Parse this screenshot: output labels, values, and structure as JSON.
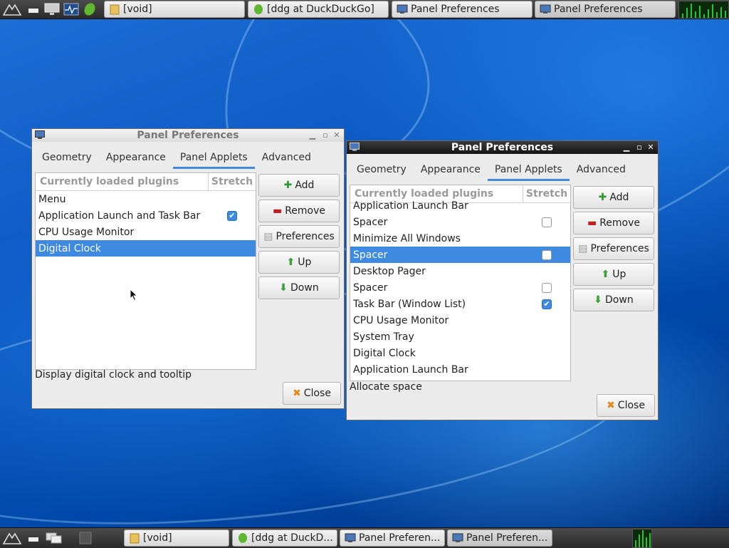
{
  "top_panel": {
    "tasks": [
      {
        "label": "[void]"
      },
      {
        "label": "[ddg at DuckDuckGo]"
      },
      {
        "label": "Panel Preferences"
      },
      {
        "label": "Panel Preferences"
      }
    ]
  },
  "bottom_panel": {
    "tasks": [
      {
        "label": "[void]"
      },
      {
        "label": "[ddg at DuckD..."
      },
      {
        "label": "Panel Preferen..."
      },
      {
        "label": "Panel Preferen..."
      }
    ]
  },
  "window1": {
    "title": "Panel Preferences",
    "tabs": [
      "Geometry",
      "Appearance",
      "Panel Applets",
      "Advanced"
    ],
    "selected_tab": "Panel Applets",
    "col_plugins": "Currently loaded plugins",
    "col_stretch": "Stretch",
    "rows": [
      {
        "name": "Menu",
        "stretch": null
      },
      {
        "name": "Application Launch and Task Bar",
        "stretch": true
      },
      {
        "name": "CPU Usage Monitor",
        "stretch": null
      },
      {
        "name": "Digital Clock",
        "stretch": null
      }
    ],
    "selected_row": 3,
    "buttons": {
      "add": "Add",
      "remove": "Remove",
      "preferences": "Preferences",
      "up": "Up",
      "down": "Down",
      "close": "Close"
    },
    "status": "Display digital clock and tooltip"
  },
  "window2": {
    "title": "Panel Preferences",
    "tabs": [
      "Geometry",
      "Appearance",
      "Panel Applets",
      "Advanced"
    ],
    "selected_tab": "Panel Applets",
    "col_plugins": "Currently loaded plugins",
    "col_stretch": "Stretch",
    "rows": [
      {
        "name": "Application Launch Bar",
        "stretch": null
      },
      {
        "name": "Spacer",
        "stretch": false
      },
      {
        "name": "Minimize All Windows",
        "stretch": null
      },
      {
        "name": "Spacer",
        "stretch": false
      },
      {
        "name": "Desktop Pager",
        "stretch": null
      },
      {
        "name": "Spacer",
        "stretch": false
      },
      {
        "name": "Task Bar (Window List)",
        "stretch": true
      },
      {
        "name": "CPU Usage Monitor",
        "stretch": null
      },
      {
        "name": "System Tray",
        "stretch": null
      },
      {
        "name": "Digital Clock",
        "stretch": null
      },
      {
        "name": "Application Launch Bar",
        "stretch": null
      }
    ],
    "selected_row": 3,
    "buttons": {
      "add": "Add",
      "remove": "Remove",
      "preferences": "Preferences",
      "up": "Up",
      "down": "Down",
      "close": "Close"
    },
    "status": "Allocate space"
  },
  "colors": {
    "accent": "#3d8ae0",
    "panel": "#2f2f2f",
    "window_bg": "#ececec"
  }
}
